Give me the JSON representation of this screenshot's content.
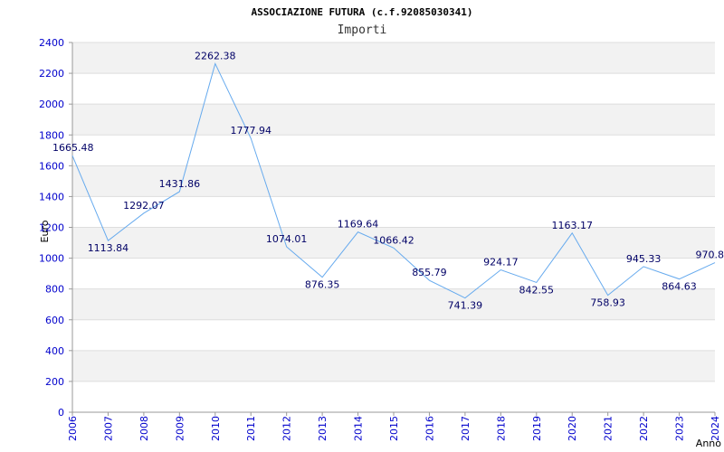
{
  "chart_data": {
    "type": "line",
    "title": "ASSOCIAZIONE FUTURA (c.f.92085030341)",
    "subtitle": "Importi",
    "xlabel": "Anno",
    "ylabel": "Euro",
    "ylim": [
      0,
      2400
    ],
    "yticks": [
      "0",
      "200",
      "400",
      "600",
      "800",
      "1000",
      "1200",
      "1400",
      "1600",
      "1800",
      "2000",
      "2200",
      "2400"
    ],
    "categories": [
      "2006",
      "2007",
      "2008",
      "2009",
      "2010",
      "2011",
      "2012",
      "2013",
      "2014",
      "2015",
      "2016",
      "2017",
      "2018",
      "2019",
      "2020",
      "2021",
      "2022",
      "2023",
      "2024"
    ],
    "values": [
      1665.48,
      1113.84,
      1292.07,
      1431.86,
      2262.38,
      1777.94,
      1074.01,
      876.35,
      1169.64,
      1066.42,
      855.79,
      741.39,
      924.17,
      842.55,
      1163.17,
      758.93,
      945.33,
      864.63,
      970.8
    ],
    "labels": [
      "1665.48",
      "1113.84",
      "1292.07",
      "1431.86",
      "2262.38",
      "1777.94",
      "1074.01",
      "876.35",
      "1169.64",
      "1066.42",
      "855.79",
      "741.39",
      "924.17",
      "842.55",
      "1163.17",
      "758.93",
      "945.33",
      "864.63",
      "970.8"
    ],
    "grid": true,
    "colors": {
      "line": "#66aaee",
      "band": "#f2f2f2",
      "tick": "#0000cc",
      "axis": "#999999"
    }
  }
}
